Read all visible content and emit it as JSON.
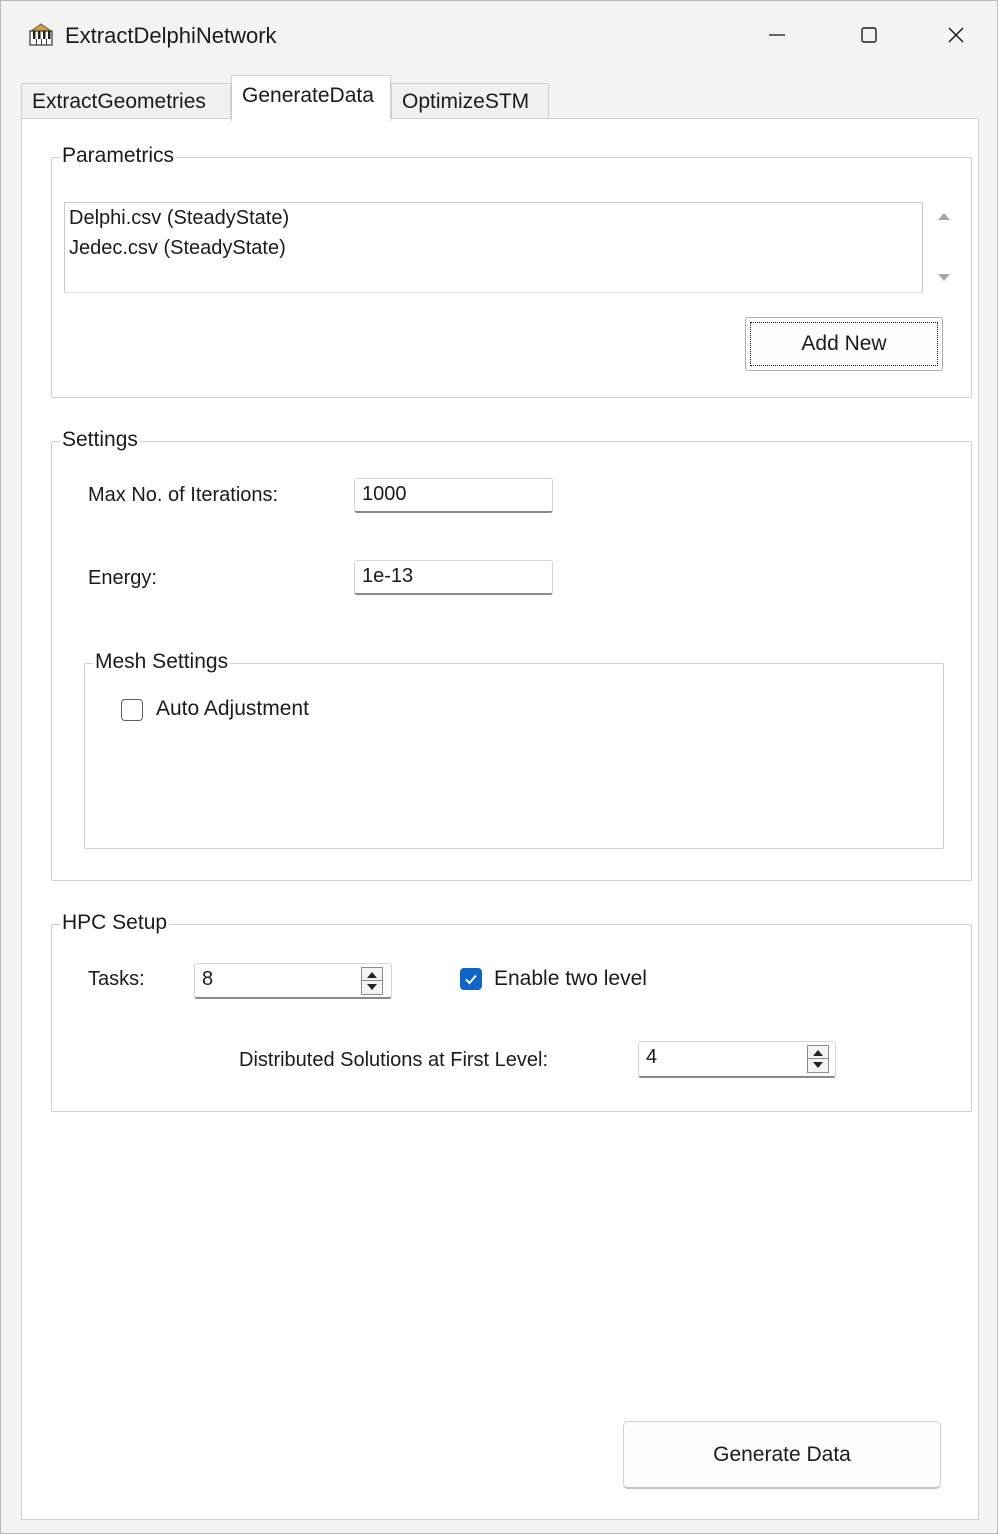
{
  "window": {
    "title": "ExtractDelphiNetwork",
    "app_icon": "piano-keys-app-icon",
    "controls": {
      "minimize_icon": "minimize-icon",
      "maximize_icon": "maximize-icon",
      "close_icon": "close-icon"
    }
  },
  "tabs": [
    {
      "label": "ExtractGeometries",
      "active": false
    },
    {
      "label": "GenerateData",
      "active": true
    },
    {
      "label": "OptimizeSTM",
      "active": false
    }
  ],
  "parametrics": {
    "title": "Parametrics",
    "items": [
      "Delphi.csv (SteadyState)",
      "Jedec.csv (SteadyState)"
    ],
    "add_new_label": "Add New"
  },
  "settings": {
    "title": "Settings",
    "max_iterations_label": "Max No. of Iterations:",
    "max_iterations_value": "1000",
    "energy_label": "Energy:",
    "energy_value": "1e-13",
    "mesh": {
      "title": "Mesh Settings",
      "auto_adjustment_label": "Auto Adjustment",
      "auto_adjustment_checked": false
    }
  },
  "hpc": {
    "title": "HPC Setup",
    "tasks_label": "Tasks:",
    "tasks_value": "8",
    "enable_two_level_label": "Enable two level",
    "enable_two_level_checked": true,
    "distributed_label": "Distributed Solutions at First Level:",
    "distributed_value": "4"
  },
  "footer": {
    "generate_label": "Generate Data"
  },
  "colors": {
    "accent": "#0f64c8",
    "window_bg": "#f3f3f3",
    "panel_bg": "#ffffff"
  }
}
